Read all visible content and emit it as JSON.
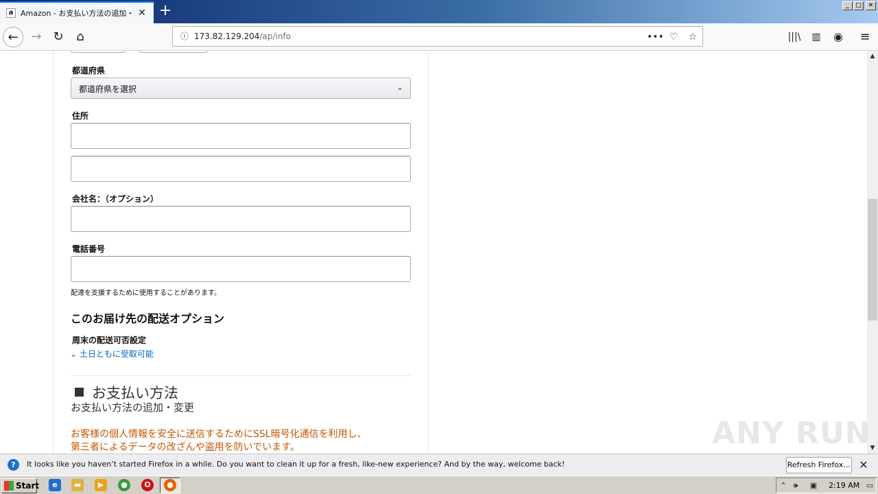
{
  "browser": {
    "tab_title": "Amazon - お支払い方法の追加・変更",
    "favicon_letter": "a",
    "new_tab_label": "+",
    "url_host": "173.82.129.204",
    "url_path": "/ap/info",
    "window_buttons": [
      "_",
      "□",
      "✕"
    ]
  },
  "form": {
    "prefecture_label": "都道府県",
    "prefecture_select_value": "都道府県を選択",
    "address_label": "住所",
    "address_line1_value": "",
    "address_line2_value": "",
    "company_label": "会社名：（オプション）",
    "company_value": "",
    "phone_label": "電話番号",
    "phone_value": "",
    "phone_hint": "配達を支援するために使用することがあります。"
  },
  "shipping_options": {
    "heading": "このお届け先の配送オプション",
    "weekend_label": "周末の配送可否設定",
    "weekend_link": "土日ともに受取可能"
  },
  "payment": {
    "heading": "お支払い方法",
    "subheading": "お支払い方法の追加・変更",
    "notice_line1": "お客様の個人情報を安全に送信するためにSSL暗号化通信を利用し、",
    "notice_line2": "第三者によるデータの改ざんや盗用を防いでいます。"
  },
  "notification": {
    "message": "It looks like you haven’t started Firefox in a while. Do you want to clean it up for a fresh, like-new experience? And by the way, welcome back!",
    "button_label": "Refresh Firefox…"
  },
  "taskbar": {
    "start_label": "Start",
    "clock": "2:19 AM"
  },
  "watermark": "ANY RUN",
  "colors": {
    "link": "#0066c0",
    "notice": "#c45500",
    "accent": "#0a84ff"
  }
}
